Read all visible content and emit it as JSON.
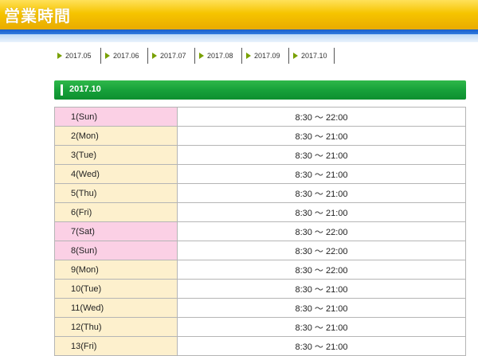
{
  "header": {
    "title": "営業時間"
  },
  "month_nav": {
    "items": [
      {
        "label": "2017.05"
      },
      {
        "label": "2017.06"
      },
      {
        "label": "2017.07"
      },
      {
        "label": "2017.08"
      },
      {
        "label": "2017.09"
      },
      {
        "label": "2017.10"
      }
    ]
  },
  "section": {
    "title": "2017.10"
  },
  "hours": {
    "rows": [
      {
        "day": "1(Sun)",
        "time": "8:30 ～ 22:00",
        "type": "holiday"
      },
      {
        "day": "2(Mon)",
        "time": "8:30 ～ 21:00",
        "type": "weekday"
      },
      {
        "day": "3(Tue)",
        "time": "8:30 ～ 21:00",
        "type": "weekday"
      },
      {
        "day": "4(Wed)",
        "time": "8:30 ～ 21:00",
        "type": "weekday"
      },
      {
        "day": "5(Thu)",
        "time": "8:30 ～ 21:00",
        "type": "weekday"
      },
      {
        "day": "6(Fri)",
        "time": "8:30 ～ 21:00",
        "type": "weekday"
      },
      {
        "day": "7(Sat)",
        "time": "8:30 ～ 22:00",
        "type": "holiday"
      },
      {
        "day": "8(Sun)",
        "time": "8:30 ～ 22:00",
        "type": "holiday"
      },
      {
        "day": "9(Mon)",
        "time": "8:30 ～ 22:00",
        "type": "weekday"
      },
      {
        "day": "10(Tue)",
        "time": "8:30 ～ 21:00",
        "type": "weekday"
      },
      {
        "day": "11(Wed)",
        "time": "8:30 ～ 21:00",
        "type": "weekday"
      },
      {
        "day": "12(Thu)",
        "time": "8:30 ～ 21:00",
        "type": "weekday"
      },
      {
        "day": "13(Fri)",
        "time": "8:30 ～ 21:00",
        "type": "weekday"
      }
    ]
  },
  "colors": {
    "header_yellow": "#f6c400",
    "header_blue_band": "#1a5fc8",
    "section_green": "#17a13a",
    "weekday_cell": "#fdf0cd",
    "holiday_cell": "#fbd0e5",
    "nav_arrow": "#78a000"
  }
}
